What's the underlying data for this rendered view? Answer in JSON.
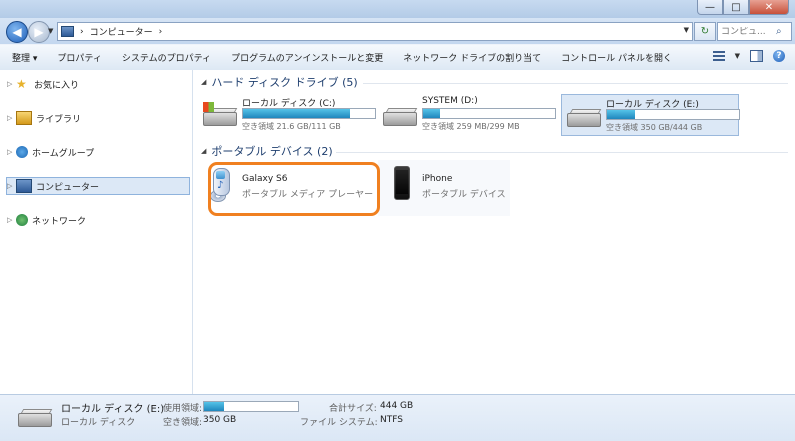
{
  "window": {
    "minimize": "—",
    "maximize": "□",
    "close": "✕"
  },
  "address": {
    "breadcrumb": "コンピューター",
    "search_placeholder": "コンピュ..."
  },
  "toolbar": {
    "items": [
      "整理 ▾",
      "プロパティ",
      "システムのプロパティ",
      "プログラムのアンインストールと変更",
      "ネットワーク ドライブの割り当て",
      "コントロール パネルを開く"
    ]
  },
  "sidebar": {
    "items": [
      {
        "label": "お気に入り",
        "icon": "star-icon"
      },
      {
        "label": "ライブラリ",
        "icon": "library-icon"
      },
      {
        "label": "ホームグループ",
        "icon": "homegroup-icon"
      },
      {
        "label": "コンピューター",
        "icon": "computer-icon",
        "selected": true
      },
      {
        "label": "ネットワーク",
        "icon": "network-icon"
      }
    ]
  },
  "groups": {
    "hdd": {
      "title": "ハード ディスク ドライブ (5)"
    },
    "portable": {
      "title": "ポータブル デバイス (2)"
    }
  },
  "drives": [
    {
      "name": "ローカル ディスク (C:)",
      "free": "空き領域 21.6 GB/111 GB",
      "used_fraction": 0.81,
      "icon": "windows-hdd-icon"
    },
    {
      "name": "SYSTEM (D:)",
      "free": "空き領域 259 MB/299 MB",
      "used_fraction": 0.13,
      "icon": "hdd-icon"
    },
    {
      "name": "ローカル ディスク (E:)",
      "free": "空き領域 350 GB/444 GB",
      "used_fraction": 0.21,
      "icon": "hdd-icon",
      "selected": true
    }
  ],
  "devices": [
    {
      "name": "Galaxy S6",
      "type": "ポータブル メディア プレーヤー",
      "icon": "media-player-icon"
    },
    {
      "name": "iPhone",
      "type": "ポータブル デバイス",
      "icon": "iphone-icon"
    }
  ],
  "details": {
    "name": "ローカル ディスク (E:)",
    "type": "ローカル ディスク",
    "used_label": "使用領域:",
    "free_label": "空き領域:",
    "free_value": "350 GB",
    "total_label": "合計サイズ:",
    "total_value": "444 GB",
    "fs_label": "ファイル システム:",
    "fs_value": "NTFS",
    "used_fraction": 0.21
  }
}
